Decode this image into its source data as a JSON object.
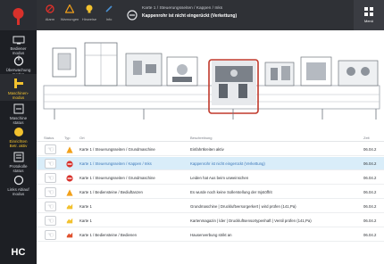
{
  "sidebar": {
    "items": [
      {
        "label": "Bediener\nmodus"
      },
      {
        "label": "Überwachung\nmodus"
      },
      {
        "label": "Maschinen-\nmodus"
      },
      {
        "label": "Maschine\nstatus"
      },
      {
        "label": "Einrichten\nBetr. aktiv"
      },
      {
        "label": "Protokolle\nstatus"
      },
      {
        "label": "Links Ablauf\nmodus"
      }
    ],
    "logo": "HC"
  },
  "topbar": {
    "alarms": [
      {
        "label": "Alarm",
        "color": "#d8312b"
      },
      {
        "label": "Warnungen",
        "color": "#f2a019"
      },
      {
        "label": "Hinweise",
        "color": "#f2c12e"
      },
      {
        "label": "Info",
        "color": "#4a8fd0"
      }
    ],
    "breadcrumb": "Karte 1 / Steuerungsseiten / Kappen / Inks",
    "message": "Kappenrohr ist nicht eingerückt (Verkettung)",
    "menu_label": "Menü"
  },
  "table": {
    "headers": [
      "Status",
      "Typ",
      "Ort",
      "Beschreibung",
      "Zeit"
    ],
    "rows": [
      {
        "severity": "warning",
        "location": "Karte 1 / Steuerungsseiten / Grundmaschine",
        "description": "Einfahrtkreiten aktiv",
        "date": "06.04.2"
      },
      {
        "severity": "error",
        "location": "Karte 1 / Steuerungsseiten / Kappen / Inks",
        "description": "Kappenrohr ist nicht eingerückt (Verkettung)",
        "date": "06.04.2",
        "selected": true
      },
      {
        "severity": "error",
        "location": "Karte 1 / Steuerungsseiten / Grundmaschine",
        "description": "Leiden hat Aus beim unweinschen",
        "date": "06.04.2"
      },
      {
        "severity": "warning",
        "location": "Karte 1 / Bediensteine / Bediuftanzen",
        "description": "Es wurde noch keine Sollerstellung der Injstöffrit",
        "date": "06.04.2"
      },
      {
        "severity": "info",
        "location": "Karte 1",
        "description": "Grundmaschine | Druckluftversorgerkert | wird prüfen (141,Pa)",
        "date": "06.04.2"
      },
      {
        "severity": "info",
        "location": "Karte 1",
        "description": "Kartenmagazin | lder | Druckluftsensortypenhaft | Ventil prüfen (141,Pa)",
        "date": "06.04.2"
      },
      {
        "severity": "info-alt",
        "location": "Karte 1 / Bediensteine / Bedienen",
        "description": "Hausenverbung strikt an",
        "date": "06.04.2"
      }
    ]
  },
  "colors": {
    "accent": "#f2c12e",
    "error": "#d8312b",
    "warning": "#f2a019",
    "highlight_box": "#c0392b",
    "selected_row": "#d9edf9"
  }
}
